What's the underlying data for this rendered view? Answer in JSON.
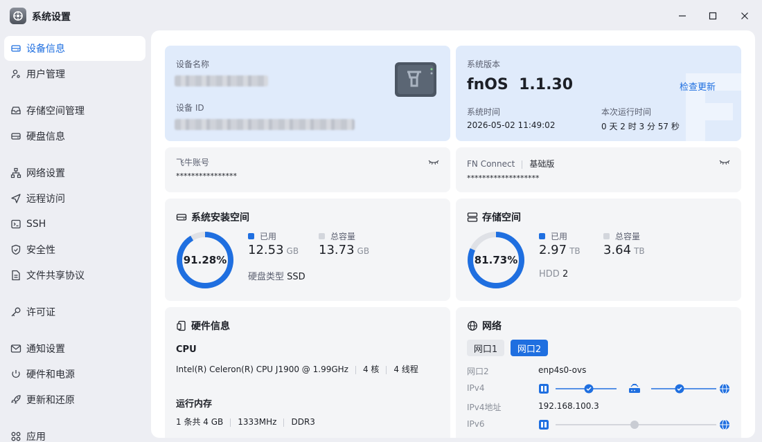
{
  "app": {
    "title": "系统设置"
  },
  "sidebar": {
    "items": [
      {
        "label": "设备信息",
        "icon": "device-icon"
      },
      {
        "label": "用户管理",
        "icon": "user-icon"
      },
      {
        "label": "存储空间管理",
        "icon": "storage-icon"
      },
      {
        "label": "硬盘信息",
        "icon": "disk-icon"
      },
      {
        "label": "网络设置",
        "icon": "network-icon"
      },
      {
        "label": "远程访问",
        "icon": "send-icon"
      },
      {
        "label": "SSH",
        "icon": "terminal-icon"
      },
      {
        "label": "安全性",
        "icon": "shield-icon"
      },
      {
        "label": "文件共享协议",
        "icon": "file-icon"
      },
      {
        "label": "许可证",
        "icon": "key-icon"
      },
      {
        "label": "通知设置",
        "icon": "mail-icon"
      },
      {
        "label": "硬件和电源",
        "icon": "power-icon"
      },
      {
        "label": "更新和还原",
        "icon": "rocket-icon"
      },
      {
        "label": "应用",
        "icon": "apps-icon"
      }
    ]
  },
  "device": {
    "name_label": "设备名称",
    "id_label": "设备 ID"
  },
  "version": {
    "label": "系统版本",
    "value": "fnOS  1.1.30",
    "check_update": "检查更新",
    "time_label": "系统时间",
    "time_value": "2026-05-02 11:49:02",
    "uptime_label": "本次运行时间",
    "uptime_value": "0 天 2 时 3 分 57 秒"
  },
  "account": {
    "label": "飞牛账号",
    "value": "****************"
  },
  "connect": {
    "label": "FN Connect",
    "tier": "基础版",
    "value": "*******************"
  },
  "system_space": {
    "title": "系统安装空间",
    "percent_text": "91.28%",
    "percent": 0.9128,
    "used_label": "已用",
    "used_value": "12.53",
    "used_unit": "GB",
    "total_label": "总容量",
    "total_value": "13.73",
    "total_unit": "GB",
    "disk_type_label": "硬盘类型",
    "disk_type_value": "SSD"
  },
  "storage_space": {
    "title": "存储空间",
    "percent_text": "81.73%",
    "percent": 0.8173,
    "used_label": "已用",
    "used_value": "2.97",
    "used_unit": "TB",
    "total_label": "总容量",
    "total_value": "3.64",
    "total_unit": "TB",
    "disk_label": "HDD",
    "disk_count": "2"
  },
  "hardware": {
    "title": "硬件信息",
    "cpu_label": "CPU",
    "cpu_model": "Intel(R) Celeron(R) CPU J1900 @ 1.99GHz",
    "cpu_cores": "4 核",
    "cpu_threads": "4 线程",
    "mem_label": "运行内存",
    "mem_sticks": "1 条共 4 GB",
    "mem_speed": "1333MHz",
    "mem_type": "DDR3"
  },
  "network": {
    "title": "网络",
    "tabs": [
      "网口1",
      "网口2"
    ],
    "port_label": "网口2",
    "port_value": "enp4s0-ovs",
    "ipv4_label": "IPv4",
    "ipv4_addr_label": "IPv4地址",
    "ipv4_addr_value": "192.168.100.3",
    "ipv6_label": "IPv6"
  },
  "colors": {
    "accent": "#1f6fe0",
    "ring_track": "#dfe1e6",
    "card": "#f4f5f7",
    "card_blue": "#e0ebfb"
  }
}
